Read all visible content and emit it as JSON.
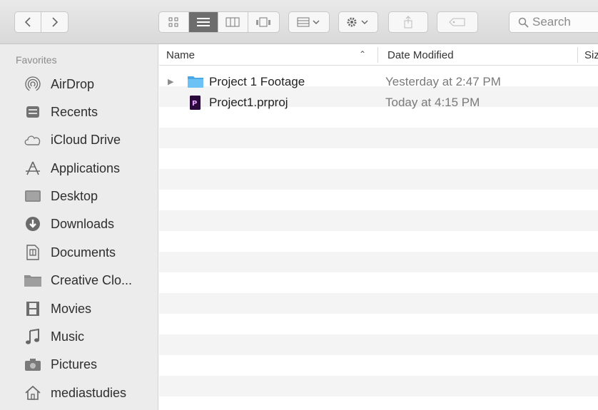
{
  "toolbar": {
    "back_icon": "chevron-left-icon",
    "forward_icon": "chevron-right-icon",
    "view_modes": [
      "icon-view-icon",
      "list-view-icon",
      "column-view-icon",
      "gallery-view-icon"
    ],
    "active_view": "list",
    "search_placeholder": "Search"
  },
  "sidebar": {
    "section_title": "Favorites",
    "items": [
      {
        "label": "AirDrop",
        "icon": "airdrop-icon"
      },
      {
        "label": "Recents",
        "icon": "recents-icon"
      },
      {
        "label": "iCloud Drive",
        "icon": "cloud-icon"
      },
      {
        "label": "Applications",
        "icon": "applications-icon"
      },
      {
        "label": "Desktop",
        "icon": "desktop-icon"
      },
      {
        "label": "Downloads",
        "icon": "downloads-icon"
      },
      {
        "label": "Documents",
        "icon": "documents-icon"
      },
      {
        "label": "Creative Clo...",
        "icon": "folder-icon"
      },
      {
        "label": "Movies",
        "icon": "movies-icon"
      },
      {
        "label": "Music",
        "icon": "music-icon"
      },
      {
        "label": "Pictures",
        "icon": "pictures-icon"
      },
      {
        "label": "mediastudies",
        "icon": "home-icon"
      }
    ]
  },
  "list": {
    "columns": {
      "name": "Name",
      "date": "Date Modified",
      "size": "Siz"
    },
    "files": [
      {
        "name": "Project 1 Footage",
        "date": "Yesterday at 2:47 PM",
        "type": "folder",
        "icon": "folder-icon"
      },
      {
        "name": "Project1.prproj",
        "date": "Today at 4:15 PM",
        "type": "premiere-project",
        "icon": "premiere-file-icon"
      }
    ]
  },
  "colors": {
    "sidebar_bg": "#ececec",
    "folder_blue": "#5ab8f0",
    "premiere_purple": "#2a0a3a",
    "stripe": "#f4f4f4",
    "active_segment": "#6d6d6d"
  }
}
